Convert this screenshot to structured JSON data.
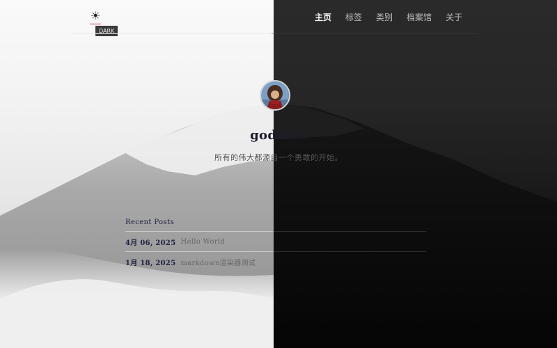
{
  "header": {
    "theme_toggle_icon": "sun-icon",
    "theme_tooltip": "DARK",
    "nav": [
      {
        "label": "主页",
        "active": true
      },
      {
        "label": "标签",
        "active": false
      },
      {
        "label": "类别",
        "active": false
      },
      {
        "label": "档案馆",
        "active": false
      },
      {
        "label": "关于",
        "active": false
      }
    ]
  },
  "profile": {
    "name": "godmao",
    "description": "所有的伟大都源自一个勇敢的开始。"
  },
  "recent_posts": {
    "heading": "Recent Posts",
    "items": [
      {
        "date": "4月 06, 2025",
        "title": "Hello World"
      },
      {
        "date": "1月 18, 2025",
        "title": "markdown渲染器测试"
      }
    ]
  },
  "colors": {
    "light_bg": "#f2f2f2",
    "dark_bg": "#1a1a1a",
    "accent": "#c33"
  }
}
